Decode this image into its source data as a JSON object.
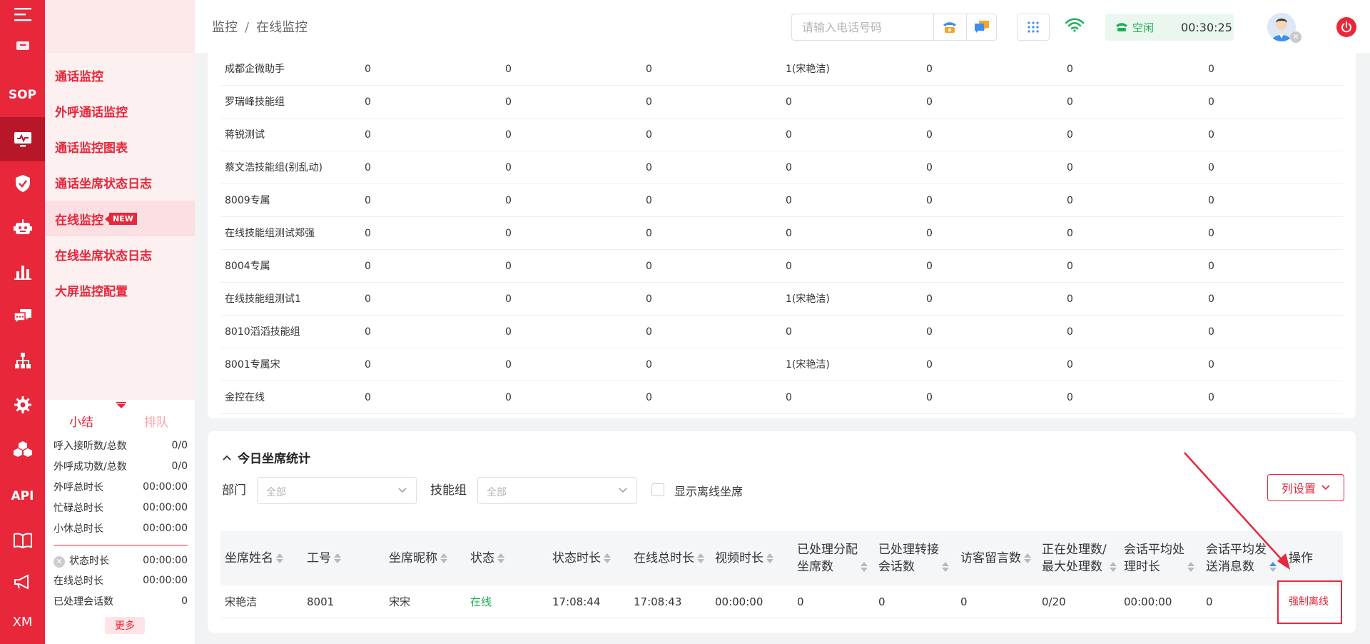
{
  "rail": {
    "items": [
      {
        "name": "box-icon"
      },
      {
        "name": "sop-icon",
        "text": "SOP"
      },
      {
        "name": "monitor-icon"
      },
      {
        "name": "shield-icon"
      },
      {
        "name": "robot-icon"
      },
      {
        "name": "bar-chart-icon"
      },
      {
        "name": "chat-icon"
      },
      {
        "name": "org-tree-icon"
      },
      {
        "name": "gear-icon"
      },
      {
        "name": "cubes-icon"
      },
      {
        "name": "api-icon",
        "text": "API"
      },
      {
        "name": "book-icon"
      },
      {
        "name": "megaphone-icon"
      },
      {
        "name": "xm-icon",
        "text": "XM"
      }
    ]
  },
  "submenu": {
    "items": [
      {
        "label": "通话监控"
      },
      {
        "label": "外呼通话监控"
      },
      {
        "label": "通话监控图表"
      },
      {
        "label": "通话坐席状态日志"
      },
      {
        "label": "在线监控",
        "badge": "NEW"
      },
      {
        "label": "在线坐席状态日志"
      },
      {
        "label": "大屏监控配置"
      }
    ]
  },
  "summary": {
    "tab_summary": "小结",
    "tab_queue": "排队",
    "rows": [
      {
        "label": "呼入接听数/总数",
        "value": "0/0"
      },
      {
        "label": "外呼成功数/总数",
        "value": "0/0"
      },
      {
        "label": "外呼总时长",
        "value": "00:00:00"
      },
      {
        "label": "忙碌总时长",
        "value": "00:00:00"
      },
      {
        "label": "小休总时长",
        "value": "00:00:00"
      },
      {
        "label": "状态时长",
        "value": "00:00:00"
      },
      {
        "label": "在线总时长",
        "value": "00:00:00"
      },
      {
        "label": "已处理会话数",
        "value": "0"
      }
    ],
    "more": "更多"
  },
  "header": {
    "breadcrumb_root": "监控",
    "breadcrumb_sep": "/",
    "breadcrumb_current": "在线监控",
    "phone_placeholder": "请输入电话号码",
    "status_text": "空闲",
    "status_time": "00:30:25"
  },
  "skill_groups": {
    "rows": [
      {
        "name": "成都企微助手",
        "c1": "0",
        "c2": "0",
        "c3": "0",
        "c4": "1(宋艳洁)",
        "c5": "0",
        "c6": "0",
        "c7": "0"
      },
      {
        "name": "罗瑞峰技能组",
        "c1": "0",
        "c2": "0",
        "c3": "0",
        "c4": "0",
        "c5": "0",
        "c6": "0",
        "c7": "0"
      },
      {
        "name": "蒋锐测试",
        "c1": "0",
        "c2": "0",
        "c3": "0",
        "c4": "0",
        "c5": "0",
        "c6": "0",
        "c7": "0"
      },
      {
        "name": "蔡文浩技能组(别乱动)",
        "c1": "0",
        "c2": "0",
        "c3": "0",
        "c4": "0",
        "c5": "0",
        "c6": "0",
        "c7": "0"
      },
      {
        "name": "8009专属",
        "c1": "0",
        "c2": "0",
        "c3": "0",
        "c4": "0",
        "c5": "0",
        "c6": "0",
        "c7": "0"
      },
      {
        "name": "在线技能组测试郑强",
        "c1": "0",
        "c2": "0",
        "c3": "0",
        "c4": "0",
        "c5": "0",
        "c6": "0",
        "c7": "0"
      },
      {
        "name": "8004专属",
        "c1": "0",
        "c2": "0",
        "c3": "0",
        "c4": "0",
        "c5": "0",
        "c6": "0",
        "c7": "0"
      },
      {
        "name": "在线技能组测试1",
        "c1": "0",
        "c2": "0",
        "c3": "0",
        "c4": "1(宋艳洁)",
        "c5": "0",
        "c6": "0",
        "c7": "0"
      },
      {
        "name": "8010滔滔技能组",
        "c1": "0",
        "c2": "0",
        "c3": "0",
        "c4": "0",
        "c5": "0",
        "c6": "0",
        "c7": "0"
      },
      {
        "name": "8001专属宋",
        "c1": "0",
        "c2": "0",
        "c3": "0",
        "c4": "1(宋艳洁)",
        "c5": "0",
        "c6": "0",
        "c7": "0"
      },
      {
        "name": "金控在线",
        "c1": "0",
        "c2": "0",
        "c3": "0",
        "c4": "0",
        "c5": "0",
        "c6": "0",
        "c7": "0"
      }
    ]
  },
  "agent_stats": {
    "title": "今日坐席统计",
    "dept_label": "部门",
    "dept_value": "全部",
    "skill_label": "技能组",
    "skill_value": "全部",
    "show_offline_label": "显示离线坐席",
    "column_settings": "列设置",
    "columns": [
      {
        "l1": "坐席姓名",
        "l2": ""
      },
      {
        "l1": "工号",
        "l2": ""
      },
      {
        "l1": "坐席昵称",
        "l2": ""
      },
      {
        "l1": "状态",
        "l2": ""
      },
      {
        "l1": "状态时长",
        "l2": ""
      },
      {
        "l1": "在线总时长",
        "l2": ""
      },
      {
        "l1": "视频时长",
        "l2": ""
      },
      {
        "l1": "已处理分配",
        "l2": "坐席数"
      },
      {
        "l1": "已处理转接",
        "l2": "会话数"
      },
      {
        "l1": "访客留言数",
        "l2": ""
      },
      {
        "l1": "正在处理数/",
        "l2": "最大处理数"
      },
      {
        "l1": "会话平均处",
        "l2": "理时长"
      },
      {
        "l1": "会话平均发",
        "l2": "送消息数"
      },
      {
        "l1": "操作",
        "l2": ""
      }
    ],
    "row": {
      "name": "宋艳洁",
      "id": "8001",
      "nickname": "宋宋",
      "status": "在线",
      "status_duration": "17:08:44",
      "online_total": "17:08:43",
      "video": "00:00:00",
      "assigned": "0",
      "transferred": "0",
      "messages": "0",
      "processing": "0/20",
      "avg_time": "00:00:00",
      "avg_msgs": "0",
      "action": "强制离线"
    }
  },
  "colors": {
    "brand": "#e8273b",
    "online": "#1fae5a"
  }
}
